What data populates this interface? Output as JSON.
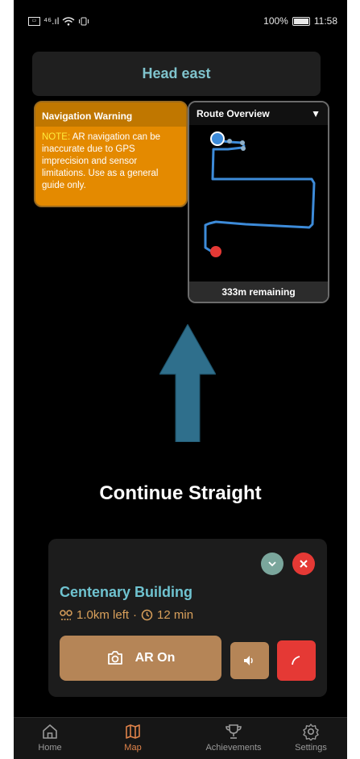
{
  "status_bar": {
    "network": "⁴⁶.ıl",
    "battery": "100%",
    "time": "11:58"
  },
  "navigation": {
    "heading": "Head east",
    "instruction": "Continue Straight"
  },
  "warning": {
    "title": "Navigation Warning",
    "note_label": "NOTE:",
    "text": " AR navigation can be inaccurate due to GPS imprecision and sensor limitations. Use as a general guide only."
  },
  "route_overview": {
    "title": "Route Overview",
    "toggle_glyph": "▼",
    "remaining": "333m remaining"
  },
  "destination": {
    "name": "Centenary Building",
    "distance": "1.0km left",
    "separator": "·",
    "time": "12 min",
    "ar_label": "AR On"
  },
  "nav_items": [
    {
      "label": "Home"
    },
    {
      "label": "Map"
    },
    {
      "label": "Achievements"
    },
    {
      "label": "Settings"
    }
  ],
  "colors": {
    "accent_teal": "#6fc3d0",
    "accent_brown": "#b58557",
    "warning_orange": "#e48a00",
    "danger_red": "#e53935",
    "route_blue": "#3d8bd9"
  }
}
